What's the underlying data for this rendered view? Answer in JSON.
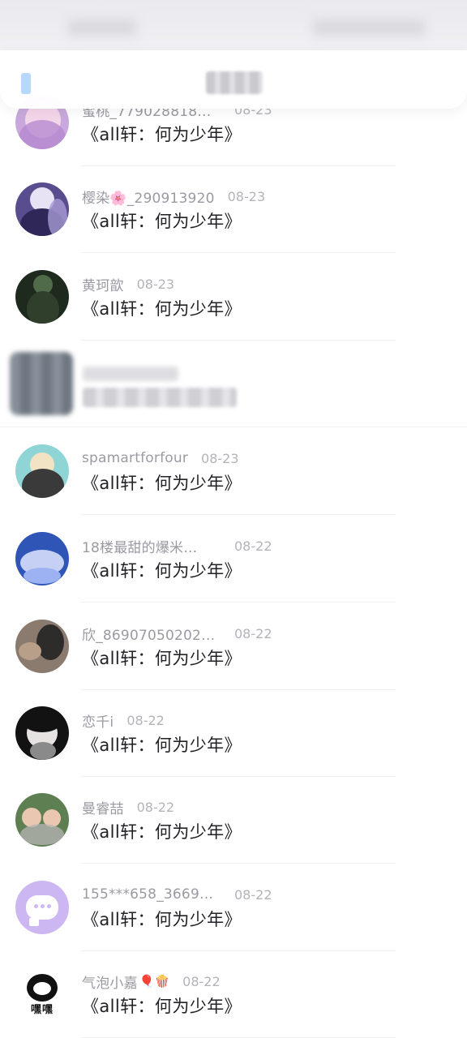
{
  "list": {
    "book_title": "《all轩：何为少年》",
    "rows": [
      {
        "username": "蜜桃_779028818…",
        "date": "08-23",
        "avatar": {
          "bg": "#c9a9dd",
          "accent": "#f3d6ea"
        }
      },
      {
        "username": "樱染🌸_290913920",
        "date": "08-23",
        "avatar": {
          "bg": "#5a4d8f",
          "accent": "#e7e2f4"
        }
      },
      {
        "username": "黄珂歆",
        "date": "08-23",
        "avatar": {
          "bg": "#1f2a1e",
          "accent": "#4f6b4a"
        }
      },
      {
        "blurred": true
      },
      {
        "username": "spamartforfour",
        "date": "08-23",
        "avatar": {
          "bg": "#8fd5d6",
          "accent": "#f2e3c5"
        }
      },
      {
        "username": "18楼最甜的爆米…",
        "date": "08-22",
        "avatar": {
          "bg": "#2f55b7",
          "accent": "#dfe6ff"
        }
      },
      {
        "username": "欣_86907050202…",
        "date": "08-22",
        "avatar": {
          "bg": "#8b7b6f",
          "accent": "#2e2b2b"
        }
      },
      {
        "username": "恋千i",
        "date": "08-22",
        "avatar": {
          "bg": "#121212",
          "accent": "#8a8a8a"
        }
      },
      {
        "username": "曼睿喆",
        "date": "08-22",
        "avatar": {
          "bg": "#5e7f52",
          "accent": "#e9c7b1"
        }
      },
      {
        "username": "155***658_36695…",
        "date": "08-22",
        "avatar": {
          "bg": "#cdb7f2",
          "accent": "#ffffff"
        }
      },
      {
        "username": "气泡小嘉",
        "emoji": "🎈🍿",
        "date": "08-22",
        "avatar": {
          "bg": "#ffffff",
          "accent": "#111111",
          "label": "嘿嘿"
        }
      }
    ]
  }
}
